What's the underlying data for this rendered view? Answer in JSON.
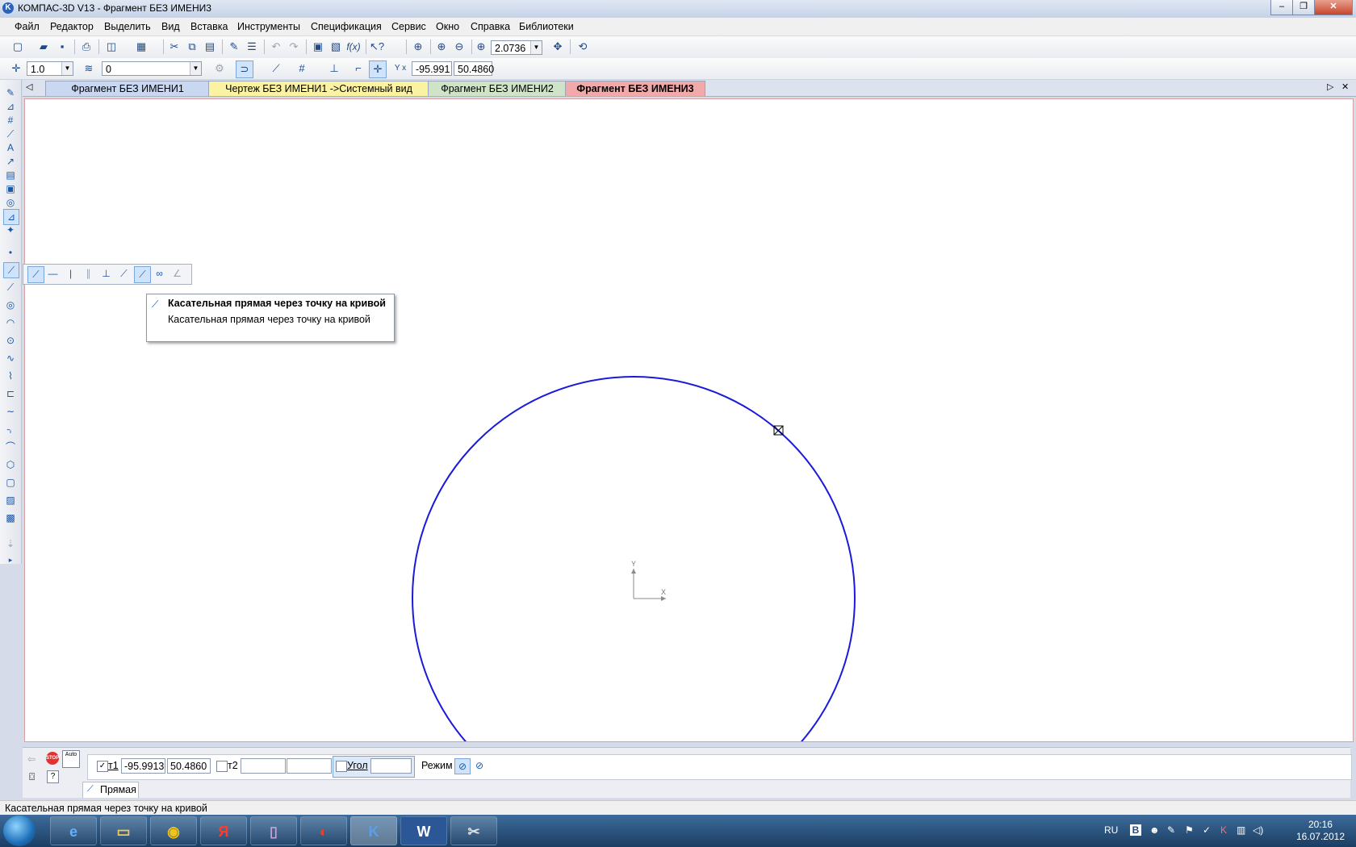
{
  "window": {
    "title": "КОМПАС-3D V13 - Фрагмент БЕЗ ИМЕНИ3",
    "app_icon_letter": "K",
    "minimize_glyph": "–",
    "maximize_glyph": "❐",
    "close_glyph": "✕"
  },
  "menu": {
    "items": [
      "Файл",
      "Редактор",
      "Выделить",
      "Вид",
      "Вставка",
      "Инструменты",
      "Спецификация",
      "Сервис",
      "Окно",
      "Справка",
      "Библиотеки"
    ]
  },
  "toolbar": {
    "zoom_value": "2.0736",
    "step_value": "1.0",
    "layer_value": "0",
    "coord_x": "-95.991",
    "coord_y": "50.4860",
    "coord_label": "Y x"
  },
  "tabs": [
    {
      "label": "Фрагмент БЕЗ ИМЕНИ1",
      "color": "#c9d7f0"
    },
    {
      "label": "Чертеж БЕЗ ИМЕНИ1 ->Системный вид",
      "color": "#fbf3a2"
    },
    {
      "label": "Фрагмент БЕЗ ИМЕНИ2",
      "color": "#cfe3c7"
    },
    {
      "label": "Фрагмент БЕЗ ИМЕНИ3",
      "color": "#f2a9a9",
      "active": true
    }
  ],
  "tabnav": {
    "left": "◁",
    "right": "▷",
    "close": "✕"
  },
  "tooltip": {
    "title": "Касательная прямая через точку на кривой",
    "description": "Касательная прямая через точку на кривой"
  },
  "canvas": {
    "axis_x_label": "X",
    "axis_y_label": "Y",
    "circle_color": "#1a1adb"
  },
  "property_panel": {
    "t1_label": "т1",
    "t1_x": "-95.9913",
    "t1_y": "50.4860",
    "t2_label": "т2",
    "t2_x": "",
    "t2_y": "",
    "angle_label": "Угол",
    "angle_value": "",
    "mode_label": "Режим",
    "stop_label": "STOP",
    "auto_label": "Auto",
    "tab_label": "Прямая"
  },
  "status": {
    "text": "Касательная прямая через точку на кривой"
  },
  "taskbar": {
    "items": [
      {
        "name": "ie",
        "glyph": "e",
        "color": "#5fb0ff"
      },
      {
        "name": "explorer",
        "glyph": "▭",
        "color": "#f1c75b"
      },
      {
        "name": "chrome",
        "glyph": "◉",
        "color": "#f0c419"
      },
      {
        "name": "yandex",
        "glyph": "Я",
        "color": "#ff3b30"
      },
      {
        "name": "save-app",
        "glyph": "▯",
        "color": "#c8a0d8"
      },
      {
        "name": "media-app",
        "glyph": "◐",
        "color": "#e8412c"
      },
      {
        "name": "kompas",
        "glyph": "K",
        "color": "#5aa0e8"
      },
      {
        "name": "word",
        "glyph": "W",
        "color": "#2b5797"
      },
      {
        "name": "tool-app",
        "glyph": "✂",
        "color": "#e0e0e0"
      }
    ],
    "lang": "RU",
    "time": "20:16",
    "date": "16.07.2012"
  }
}
